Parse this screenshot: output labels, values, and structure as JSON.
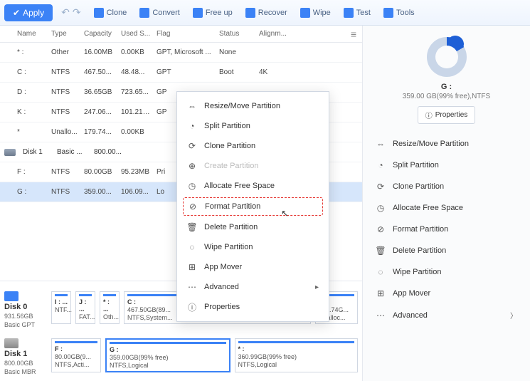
{
  "toolbar": {
    "apply": "Apply",
    "items": [
      "Clone",
      "Convert",
      "Free up",
      "Recover",
      "Wipe",
      "Test",
      "Tools"
    ]
  },
  "table": {
    "headers": {
      "name": "Name",
      "type": "Type",
      "capacity": "Capacity",
      "used": "Used S...",
      "flag": "Flag",
      "status": "Status",
      "align": "Alignm..."
    },
    "rows": [
      {
        "name": "* :",
        "type": "Other",
        "cap": "16.00MB",
        "used": "0.00KB",
        "flag": "GPT, Microsoft ...",
        "status": "None",
        "align": ""
      },
      {
        "name": "C :",
        "type": "NTFS",
        "cap": "467.50...",
        "used": "48.48...",
        "flag": "GPT",
        "status": "Boot",
        "align": "4K"
      },
      {
        "name": "D :",
        "type": "NTFS",
        "cap": "36.65GB",
        "used": "723.65...",
        "flag": "GP",
        "status": "",
        "align": ""
      },
      {
        "name": "K :",
        "type": "NTFS",
        "cap": "247.06...",
        "used": "101.21MB",
        "flag": "GP",
        "status": "",
        "align": ""
      },
      {
        "name": "*",
        "type": "Unallo...",
        "cap": "179.74...",
        "used": "0.00KB",
        "flag": "",
        "status": "",
        "align": ""
      }
    ],
    "disk1": {
      "label": "Disk 1",
      "type": "Basic ...",
      "cap": "800.00..."
    },
    "rows2": [
      {
        "name": "F :",
        "type": "NTFS",
        "cap": "80.00GB",
        "used": "95.23MB",
        "flag": "Pri",
        "status": "",
        "align": ""
      },
      {
        "name": "G :",
        "type": "NTFS",
        "cap": "359.00...",
        "used": "106.09...",
        "flag": "Lo",
        "status": "",
        "align": "",
        "sel": true
      }
    ]
  },
  "bottom": {
    "disk0": {
      "label": "Disk 0",
      "size": "931.56GB",
      "scheme": "Basic GPT",
      "parts": [
        {
          "name": "I : ...",
          "sub": "NTF..."
        },
        {
          "name": "J : ...",
          "sub": "FAT..."
        },
        {
          "name": "* : ...",
          "sub": "Oth..."
        },
        {
          "name": "C :",
          "sub": "467.50GB(89...",
          "sub2": "NTFS,System..."
        },
        {
          "name": "* :",
          "sub": "179.74G...",
          "sub2": "Unalloc..."
        }
      ]
    },
    "disk1": {
      "label": "Disk 1",
      "size": "800.00GB",
      "scheme": "Basic MBR",
      "parts": [
        {
          "name": "F :",
          "sub": "80.00GB(9...",
          "sub2": "NTFS,Acti..."
        },
        {
          "name": "G :",
          "sub": "359.00GB(99% free)",
          "sub2": "NTFS,Logical",
          "sel": true
        },
        {
          "name": "* :",
          "sub": "360.99GB(99% free)",
          "sub2": "NTFS,Logical"
        }
      ]
    }
  },
  "ctx": {
    "items": [
      {
        "icon": "⇔",
        "label": "Resize/Move Partition"
      },
      {
        "icon": "◔",
        "label": "Split Partition"
      },
      {
        "icon": "⟳",
        "label": "Clone Partition"
      },
      {
        "icon": "⊕",
        "label": "Create Partition",
        "disabled": true
      },
      {
        "icon": "◷",
        "label": "Allocate Free Space"
      },
      {
        "icon": "⊘",
        "label": "Format Partition",
        "hl": true
      },
      {
        "icon": "🗑",
        "label": "Delete Partition"
      },
      {
        "icon": "◌",
        "label": "Wipe Partition"
      },
      {
        "icon": "⊞",
        "label": "App Mover"
      },
      {
        "icon": "⋯",
        "label": "Advanced",
        "arrow": true
      },
      {
        "icon": "ⓘ",
        "label": "Properties"
      }
    ]
  },
  "side": {
    "title": "G :",
    "sub": "359.00 GB(99% free),NTFS",
    "prop": "Properties",
    "actions": [
      {
        "icon": "⇔",
        "label": "Resize/Move Partition"
      },
      {
        "icon": "◔",
        "label": "Split Partition"
      },
      {
        "icon": "⟳",
        "label": "Clone Partition"
      },
      {
        "icon": "◷",
        "label": "Allocate Free Space"
      },
      {
        "icon": "⊘",
        "label": "Format Partition"
      },
      {
        "icon": "🗑",
        "label": "Delete Partition"
      },
      {
        "icon": "◌",
        "label": "Wipe Partition"
      },
      {
        "icon": "⊞",
        "label": "App Mover"
      },
      {
        "icon": "⋯",
        "label": "Advanced",
        "arrow": true
      }
    ]
  }
}
